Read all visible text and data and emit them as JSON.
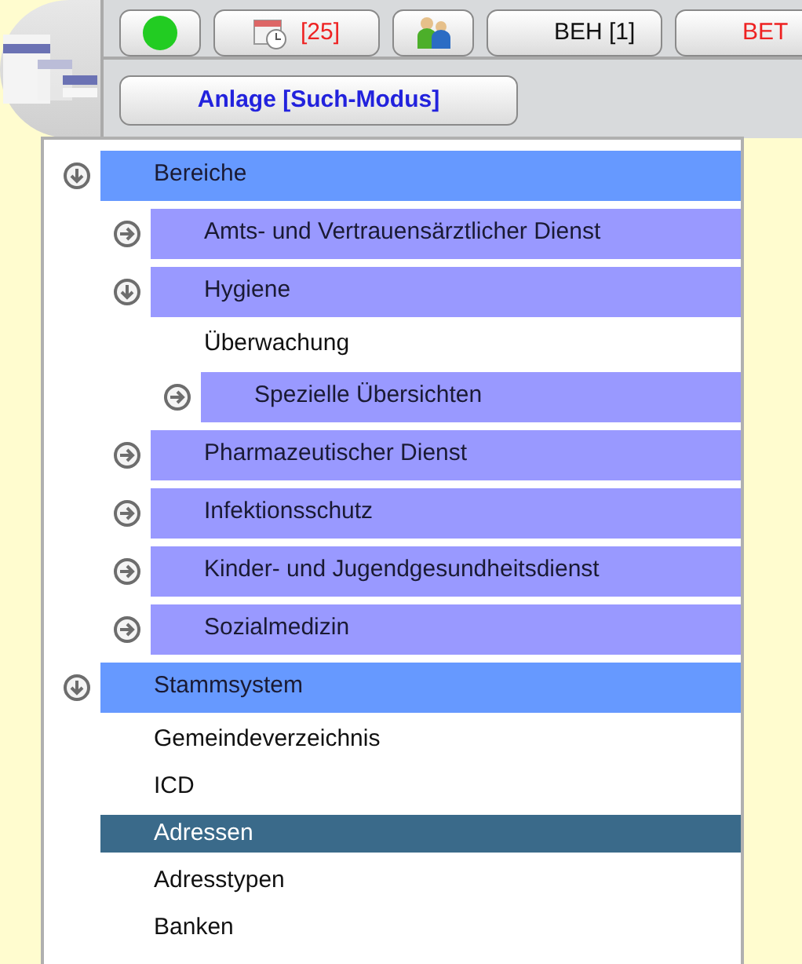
{
  "toolbar": [
    {
      "kind": "status",
      "color": "#22cc22"
    },
    {
      "kind": "calendar",
      "label": "[25]",
      "color": "#ee2222"
    },
    {
      "kind": "people"
    },
    {
      "kind": "text",
      "label": "BEH [1]",
      "color": "#111111"
    },
    {
      "kind": "text",
      "label": "BET",
      "color": "#ee2222"
    }
  ],
  "mode_button": {
    "label": "Anlage [Such-Modus]"
  },
  "tree": [
    {
      "label": "Bereiche",
      "expanded": true,
      "children": [
        {
          "label": "Amts- und Vertrauensärztlicher Dienst",
          "expanded": false
        },
        {
          "label": "Hygiene",
          "expanded": true,
          "children": [
            {
              "label": "Überwachung",
              "selected": false
            },
            {
              "label": "Spezielle Übersichten",
              "expanded": false
            }
          ]
        },
        {
          "label": "Pharmazeutischer Dienst",
          "expanded": false
        },
        {
          "label": "Infektionsschutz",
          "expanded": false
        },
        {
          "label": "Kinder- und Jugendgesundheitsdienst",
          "expanded": false
        },
        {
          "label": "Sozialmedizin",
          "expanded": false
        }
      ]
    },
    {
      "label": "Stammsystem",
      "expanded": true,
      "children": [
        {
          "label": "Gemeindeverzeichnis",
          "selected": false
        },
        {
          "label": "ICD",
          "selected": false
        },
        {
          "label": "Adressen",
          "selected": true
        },
        {
          "label": "Adresstypen",
          "selected": false
        },
        {
          "label": "Banken",
          "selected": false
        }
      ]
    }
  ]
}
